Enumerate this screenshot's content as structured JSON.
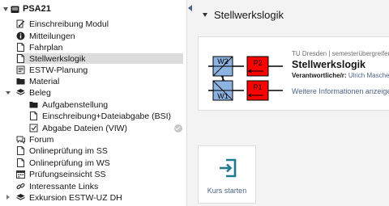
{
  "nav": {
    "root_label": "PSA21",
    "items": [
      {
        "label": "Einschreibung Modul",
        "icon": "register-icon"
      },
      {
        "label": "Mitteilungen",
        "icon": "info-icon"
      },
      {
        "label": "Fahrplan",
        "icon": "file-icon"
      },
      {
        "label": "Stellwerkslogik",
        "icon": "file-icon",
        "selected": true
      },
      {
        "label": "ESTW-Planung",
        "icon": "document-icon"
      },
      {
        "label": "Material",
        "icon": "folder-icon"
      },
      {
        "label": "Beleg",
        "icon": "learning-module-icon",
        "expanded": true
      },
      {
        "label": "Aufgabenstellung",
        "icon": "folder-icon"
      },
      {
        "label": "Einschreibung+Dateiabgabe (BSI)",
        "icon": "file-icon"
      },
      {
        "label": "Abgabe Dateien (VIW)",
        "icon": "exercise-icon",
        "completed": true
      },
      {
        "label": "Forum",
        "icon": "forum-icon"
      },
      {
        "label": "Onlineprüfung im SS",
        "icon": "file-icon"
      },
      {
        "label": "Onlineprüfung im WS",
        "icon": "file-icon"
      },
      {
        "label": "Prüfungseinsicht SS",
        "icon": "calendar-icon"
      },
      {
        "label": "Interessante Links",
        "icon": "link-icon"
      },
      {
        "label": "Exkursion ESTW-UZ DH",
        "icon": "learning-module-icon",
        "expandable": true
      }
    ]
  },
  "main": {
    "heading": "Stellwerkslogik",
    "card": {
      "meta": "TU Dresden | semesterübergreifend",
      "title": "Stellwerkslogik",
      "responsible_label": "Verantwortliche/r:",
      "responsible_name": "Ulrich Maschek",
      "more_link": "Weitere Informationen anzeigen",
      "diagram_labels": {
        "w2": "W2",
        "p2": "P2",
        "w1": "W1",
        "p1": "P1"
      }
    },
    "start_label": "Kurs starten"
  },
  "colors": {
    "accent": "#4c6586",
    "selected_row": "#dcdcdc",
    "switch_blue": "#8db3e2",
    "signal_red": "#ff0000"
  }
}
